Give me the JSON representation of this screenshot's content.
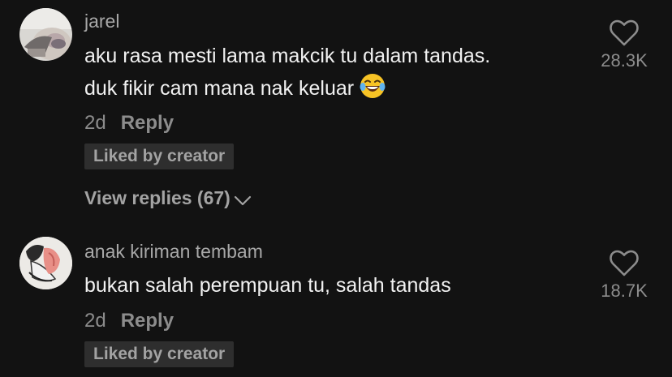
{
  "comments": [
    {
      "username": "jarel",
      "lines": [
        "aku rasa mesti lama makcik tu dalam tandas.",
        "duk fikir cam mana nak keluar"
      ],
      "emoji": "face-with-tears-of-joy",
      "age": "2d",
      "reply_label": "Reply",
      "badge": "Liked by creator",
      "view_replies": "View replies (67)",
      "likes": "28.3K"
    },
    {
      "username": "anak kiriman tembam",
      "lines": [
        "bukan salah perempuan tu, salah tandas"
      ],
      "age": "2d",
      "reply_label": "Reply",
      "badge": "Liked by creator",
      "likes": "18.7K"
    }
  ],
  "colors": {
    "background": "#121212",
    "text": "#f1f1f1",
    "muted": "#8c8c8c",
    "badge_bg": "#2e2e2e"
  }
}
